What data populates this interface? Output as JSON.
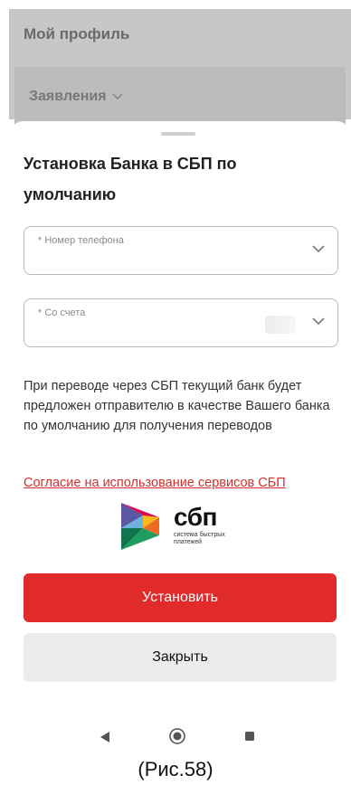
{
  "background": {
    "title": "Мой профиль",
    "tab_label": "Заявления"
  },
  "sheet": {
    "title": "Установка Банка в СБП по умолчанию",
    "phone_field": {
      "label": "* Номер телефона",
      "value": ""
    },
    "account_field": {
      "label": "* Со счета",
      "value": ""
    },
    "info_text": "При переводе через СБП текущий банк будет предложен отправителю в качестве Вашего банка по умолчанию для получения переводов",
    "consent_link": "Согласие на использование сервисов СБП",
    "logo": {
      "name": "сбп",
      "subtitle": "система быстрых платежей"
    },
    "primary_button": "Установить",
    "secondary_button": "Закрыть"
  },
  "navigation": {
    "icons": [
      "back-icon",
      "home-icon",
      "recent-apps-icon"
    ]
  },
  "caption": "(Рис.58)",
  "colors": {
    "primary": "#e12a2a",
    "link": "#d32f2f",
    "secondary_bg": "#ececef"
  }
}
